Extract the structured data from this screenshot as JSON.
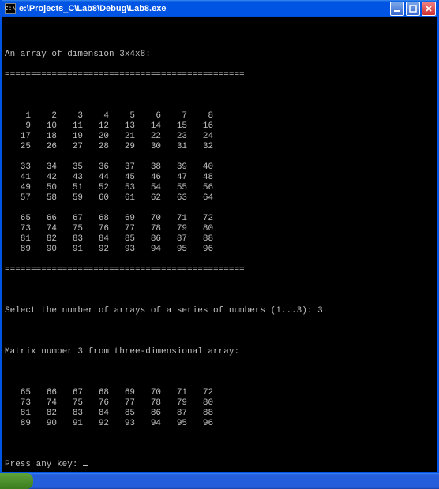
{
  "window": {
    "icon_label": "C:\\",
    "title": "e:\\Projects_C\\Lab8\\Debug\\Lab8.exe"
  },
  "console": {
    "header": "An array of dimension 3x4x8:",
    "divider": "==============================================",
    "array3d": [
      [
        [
          1,
          2,
          3,
          4,
          5,
          6,
          7,
          8
        ],
        [
          9,
          10,
          11,
          12,
          13,
          14,
          15,
          16
        ],
        [
          17,
          18,
          19,
          20,
          21,
          22,
          23,
          24
        ],
        [
          25,
          26,
          27,
          28,
          29,
          30,
          31,
          32
        ]
      ],
      [
        [
          33,
          34,
          35,
          36,
          37,
          38,
          39,
          40
        ],
        [
          41,
          42,
          43,
          44,
          45,
          46,
          47,
          48
        ],
        [
          49,
          50,
          51,
          52,
          53,
          54,
          55,
          56
        ],
        [
          57,
          58,
          59,
          60,
          61,
          62,
          63,
          64
        ]
      ],
      [
        [
          65,
          66,
          67,
          68,
          69,
          70,
          71,
          72
        ],
        [
          73,
          74,
          75,
          76,
          77,
          78,
          79,
          80
        ],
        [
          81,
          82,
          83,
          84,
          85,
          86,
          87,
          88
        ],
        [
          89,
          90,
          91,
          92,
          93,
          94,
          95,
          96
        ]
      ]
    ],
    "prompt_select": "Select the number of arrays of a series of numbers (1...3): ",
    "selected_value": "3",
    "matrix_header": "Matrix number 3 from three-dimensional array:",
    "selected_matrix": [
      [
        65,
        66,
        67,
        68,
        69,
        70,
        71,
        72
      ],
      [
        73,
        74,
        75,
        76,
        77,
        78,
        79,
        80
      ],
      [
        81,
        82,
        83,
        84,
        85,
        86,
        87,
        88
      ],
      [
        89,
        90,
        91,
        92,
        93,
        94,
        95,
        96
      ]
    ],
    "press_any_key": "Press any key: "
  }
}
